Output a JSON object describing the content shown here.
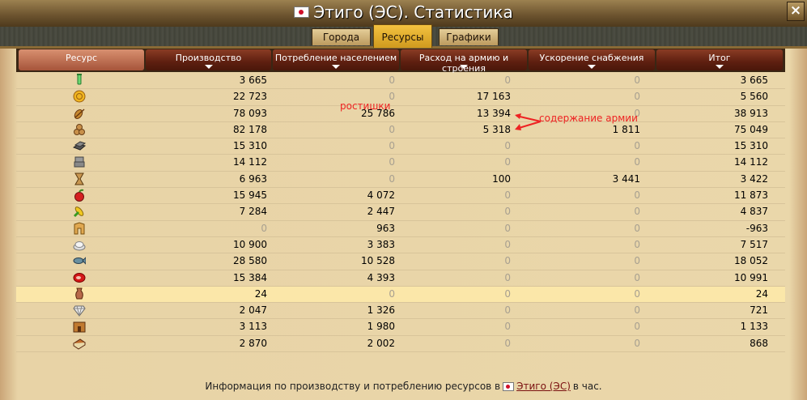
{
  "window": {
    "title": "Этиго (ЭС). Статистика"
  },
  "tabs": [
    {
      "label": "Города"
    },
    {
      "label": "Ресурсы"
    },
    {
      "label": "Графики"
    }
  ],
  "columns": [
    {
      "label": "Ресурс"
    },
    {
      "label": "Производство"
    },
    {
      "label": "Потребление населением"
    },
    {
      "label": "Расход на армию и строения"
    },
    {
      "label": "Ускорение снабжения"
    },
    {
      "label": "Итог"
    }
  ],
  "rows": [
    {
      "icon": "potion-icon",
      "production": "3 665",
      "population": "0",
      "army": "0",
      "boost": "0",
      "total": "3 665"
    },
    {
      "icon": "gold-coin-icon",
      "production": "22 723",
      "population": "0",
      "army": "17 163",
      "boost": "0",
      "total": "5 560"
    },
    {
      "icon": "sprout-icon",
      "production": "78 093",
      "population": "25 786",
      "army": "13 394",
      "boost": "0",
      "total": "38 913"
    },
    {
      "icon": "logs-icon",
      "production": "82 178",
      "population": "0",
      "army": "5 318",
      "boost": "1 811",
      "total": "75 049"
    },
    {
      "icon": "iron-icon",
      "production": "15 310",
      "population": "0",
      "army": "0",
      "boost": "0",
      "total": "15 310"
    },
    {
      "icon": "stone-icon",
      "production": "14 112",
      "population": "0",
      "army": "0",
      "boost": "0",
      "total": "14 112"
    },
    {
      "icon": "hourglass-icon",
      "production": "6 963",
      "population": "0",
      "army": "100",
      "boost": "3 441",
      "total": "3 422"
    },
    {
      "icon": "apple-icon",
      "production": "15 945",
      "population": "4 072",
      "army": "0",
      "boost": "0",
      "total": "11 873"
    },
    {
      "icon": "corn-icon",
      "production": "7 284",
      "population": "2 447",
      "army": "0",
      "boost": "0",
      "total": "4 837"
    },
    {
      "icon": "wheat-icon",
      "production": "0",
      "population": "963",
      "army": "0",
      "boost": "0",
      "total": "-963"
    },
    {
      "icon": "rice-icon",
      "production": "10 900",
      "population": "3 383",
      "army": "0",
      "boost": "0",
      "total": "7 517"
    },
    {
      "icon": "fish-icon",
      "production": "28 580",
      "population": "10 528",
      "army": "0",
      "boost": "0",
      "total": "18 052"
    },
    {
      "icon": "meat-icon",
      "production": "15 384",
      "population": "4 393",
      "army": "0",
      "boost": "0",
      "total": "10 991"
    },
    {
      "icon": "vase-icon",
      "production": "24",
      "population": "0",
      "army": "0",
      "boost": "0",
      "total": "24",
      "highlight": true
    },
    {
      "icon": "diamond-icon",
      "production": "2 047",
      "population": "1 326",
      "army": "0",
      "boost": "0",
      "total": "721"
    },
    {
      "icon": "building-icon",
      "production": "3 113",
      "population": "1 980",
      "army": "0",
      "boost": "0",
      "total": "1 133"
    },
    {
      "icon": "book-icon",
      "production": "2 870",
      "population": "2 002",
      "army": "0",
      "boost": "0",
      "total": "868"
    }
  ],
  "annotations": {
    "sprouts": "ростишки",
    "army_upkeep": "содержание армии"
  },
  "footer": {
    "prefix": "Информация по производству и потреблению ресурсов в",
    "link": "Этиго (ЭС)",
    "suffix": "в час."
  }
}
